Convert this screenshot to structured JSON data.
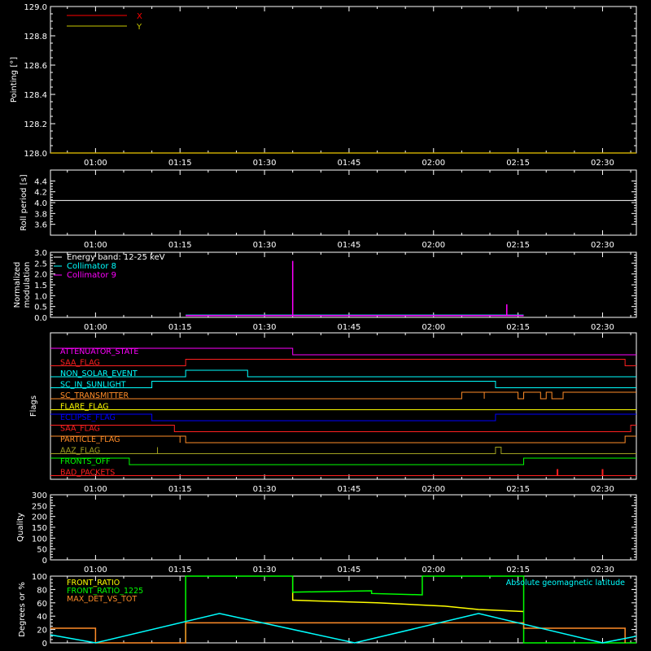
{
  "time_ticks": [
    "01:00",
    "01:15",
    "01:30",
    "01:45",
    "02:00",
    "02:15",
    "02:30"
  ],
  "colors": {
    "background": "#000000",
    "axis": "#ffffff",
    "x": "#ff0000",
    "y": "#c8c800",
    "magenta": "#ff00ff",
    "cyan": "#00ffff",
    "red": "#ff2020",
    "orange": "#ff8c28",
    "yellow": "#ffff00",
    "blue": "#0000ff",
    "olive": "#a0a020",
    "green": "#00ff00"
  },
  "chart_data": [
    {
      "id": "pointing",
      "type": "line",
      "ylabel": "Pointing [°]",
      "ylim": [
        128.0,
        129.0
      ],
      "yticks": [
        "128.0",
        "128.2",
        "128.4",
        "128.6",
        "128.8",
        "129.0"
      ],
      "legend": [
        "X",
        "Y"
      ],
      "series": [
        {
          "name": "X",
          "color": "#ff0000",
          "x": [
            "00:52",
            "02:36"
          ],
          "y": [
            128.0,
            128.0
          ]
        },
        {
          "name": "Y",
          "color": "#c8c800",
          "x": [
            "00:52",
            "02:36"
          ],
          "y": [
            128.0,
            128.0
          ]
        }
      ]
    },
    {
      "id": "roll",
      "type": "line",
      "ylabel": "Roll period [s]",
      "ylim": [
        3.4,
        4.6
      ],
      "yticks": [
        "3.6",
        "3.8",
        "4.0",
        "4.2",
        "4.4"
      ],
      "series": [
        {
          "color": "#ffffff",
          "x": [
            "00:52",
            "02:36"
          ],
          "y": [
            4.04,
            4.04
          ]
        }
      ]
    },
    {
      "id": "modulation",
      "type": "line",
      "ylabel_lines": [
        "Normalized",
        "modulation"
      ],
      "ylim": [
        0.0,
        3.0
      ],
      "yticks": [
        "0.0",
        "0.5",
        "1.0",
        "1.5",
        "2.0",
        "2.5",
        "3.0"
      ],
      "legend": [
        "Energy band: 12-25 keV",
        "Collimator 8",
        "Collimator 9"
      ],
      "series": [
        {
          "name": "Collimator 8",
          "color": "#00ffff",
          "x": [
            "01:16",
            "02:16"
          ],
          "y": [
            0.1,
            0.1
          ]
        },
        {
          "name": "Collimator 9",
          "color": "#ff00ff",
          "x": [
            "01:16",
            "01:35",
            "01:35",
            "01:35",
            "02:13",
            "02:13",
            "02:13",
            "02:16"
          ],
          "y": [
            0.08,
            0.08,
            2.6,
            0.08,
            0.08,
            0.6,
            0.08,
            0.08
          ]
        }
      ]
    },
    {
      "id": "flags",
      "type": "line",
      "ylabel": "Flags",
      "series": [
        {
          "name": "ATTENUATOR_STATE",
          "color": "#ff00ff",
          "segments": [
            [
              1,
              "00:52",
              "01:35"
            ],
            [
              0,
              "01:35",
              "02:36"
            ]
          ]
        },
        {
          "name": "SAA_FLAG",
          "color": "#ff2020",
          "segments": [
            [
              0,
              "00:52",
              "01:16"
            ],
            [
              1,
              "01:16",
              "02:34"
            ],
            [
              0,
              "02:34",
              "02:36"
            ]
          ]
        },
        {
          "name": "NON_SOLAR_EVENT",
          "color": "#00ffff",
          "segments": [
            [
              0,
              "00:52",
              "01:16"
            ],
            [
              1,
              "01:16",
              "01:27"
            ],
            [
              0,
              "01:27",
              "02:36"
            ]
          ]
        },
        {
          "name": "SC_IN_SUNLIGHT",
          "color": "#00ffff",
          "segments": [
            [
              0,
              "00:52",
              "01:10"
            ],
            [
              1,
              "01:10",
              "02:11"
            ],
            [
              0,
              "02:11",
              "02:36"
            ]
          ]
        },
        {
          "name": "SC_TRANSMITTER",
          "color": "#ff8c28",
          "segments": [
            [
              0,
              "00:52",
              "02:05"
            ],
            [
              1,
              "02:05",
              "02:09"
            ],
            [
              0,
              "02:09",
              "02:09"
            ],
            [
              1,
              "02:09",
              "02:15"
            ],
            [
              0,
              "02:15",
              "02:16"
            ],
            [
              1,
              "02:16",
              "02:19"
            ],
            [
              0,
              "02:19",
              "02:20"
            ],
            [
              1,
              "02:20",
              "02:21"
            ],
            [
              0,
              "02:21",
              "02:23"
            ],
            [
              1,
              "02:23",
              "02:36"
            ]
          ]
        },
        {
          "name": "FLARE_FLAG",
          "color": "#ffff00",
          "segments": [
            [
              0,
              "00:52",
              "02:36"
            ]
          ]
        },
        {
          "name": "ECLIPSE_FLAG",
          "color": "#0000ff",
          "segments": [
            [
              1,
              "00:52",
              "01:10"
            ],
            [
              0,
              "01:10",
              "02:11"
            ],
            [
              1,
              "02:11",
              "02:36"
            ]
          ]
        },
        {
          "name": "SAA_FLAG",
          "color": "#ff2020",
          "segments": [
            [
              1,
              "00:52",
              "01:14"
            ],
            [
              0,
              "01:14",
              "02:35"
            ],
            [
              1,
              "02:35",
              "02:36"
            ]
          ]
        },
        {
          "name": "PARTICLE_FLAG",
          "color": "#ff8c28",
          "segments": [
            [
              1,
              "00:52",
              "01:15"
            ],
            [
              0,
              "01:15",
              "01:15"
            ],
            [
              1,
              "01:15",
              "01:16"
            ],
            [
              0,
              "01:16",
              "02:34"
            ],
            [
              1,
              "02:34",
              "02:36"
            ]
          ]
        },
        {
          "name": "AAZ_FLAG",
          "color": "#a0a020",
          "segments": [
            [
              0,
              "00:52",
              "01:11"
            ],
            [
              1,
              "01:11",
              "01:11"
            ],
            [
              0,
              "01:11",
              "02:11"
            ],
            [
              1,
              "02:11",
              "02:12"
            ],
            [
              0,
              "02:12",
              "02:36"
            ]
          ]
        },
        {
          "name": "FRONTS_OFF",
          "color": "#00ff00",
          "segments": [
            [
              1,
              "00:52",
              "01:06"
            ],
            [
              0,
              "01:06",
              "02:16"
            ],
            [
              1,
              "02:16",
              "02:36"
            ]
          ]
        },
        {
          "name": "BAD_PACKETS",
          "color": "#ff2020",
          "segments": [
            [
              0,
              "00:52",
              "02:36"
            ]
          ],
          "spikes": [
            "02:22",
            "02:30"
          ]
        }
      ]
    },
    {
      "id": "quality",
      "type": "line",
      "ylabel": "Quality",
      "ylim": [
        0,
        300
      ],
      "yticks": [
        "0",
        "50",
        "100",
        "150",
        "200",
        "250",
        "300"
      ],
      "series": [
        {
          "color": "#ffffff",
          "x": [
            "00:52",
            "02:36"
          ],
          "y": [
            0,
            0
          ]
        }
      ]
    },
    {
      "id": "ratio",
      "type": "line",
      "ylabel": "Degrees or %",
      "ylim": [
        0,
        100
      ],
      "yticks": [
        "0",
        "20",
        "40",
        "60",
        "80",
        "100"
      ],
      "legend": [
        "FRONT_RATIO",
        "FRONT_RATIO_1225",
        "MAX_DET_VS_TOT"
      ],
      "legend_right": "Absolute geomagnetic latitude",
      "series": [
        {
          "name": "FRONT_RATIO",
          "color": "#ffff00",
          "x": [
            "01:35",
            "01:35",
            "01:50",
            "02:02",
            "02:08",
            "02:16"
          ],
          "y": [
            100,
            64,
            60,
            55,
            50,
            47
          ]
        },
        {
          "name": "FRONT_RATIO_1225",
          "color": "#00ff00",
          "x": [
            "01:16",
            "01:16",
            "01:35",
            "01:35",
            "01:49",
            "01:49",
            "01:58",
            "01:58",
            "02:16",
            "02:16",
            "02:36"
          ],
          "y": [
            0,
            100,
            100,
            76,
            78,
            74,
            72,
            100,
            100,
            0,
            0
          ]
        },
        {
          "name": "MAX_DET_VS_TOT",
          "color": "#ff8c28",
          "x": [
            "00:52",
            "01:00",
            "01:00",
            "01:16",
            "01:16",
            "02:16",
            "02:16",
            "02:34",
            "02:34"
          ],
          "y": [
            22,
            22,
            0,
            0,
            30,
            30,
            22,
            22,
            0
          ]
        },
        {
          "name": "Absolute geomagnetic latitude",
          "color": "#00ffff",
          "x": [
            "00:52",
            "01:00",
            "01:22",
            "01:46",
            "02:08",
            "02:30",
            "02:36"
          ],
          "y": [
            12,
            0,
            44,
            0,
            44,
            0,
            10
          ]
        }
      ]
    }
  ]
}
